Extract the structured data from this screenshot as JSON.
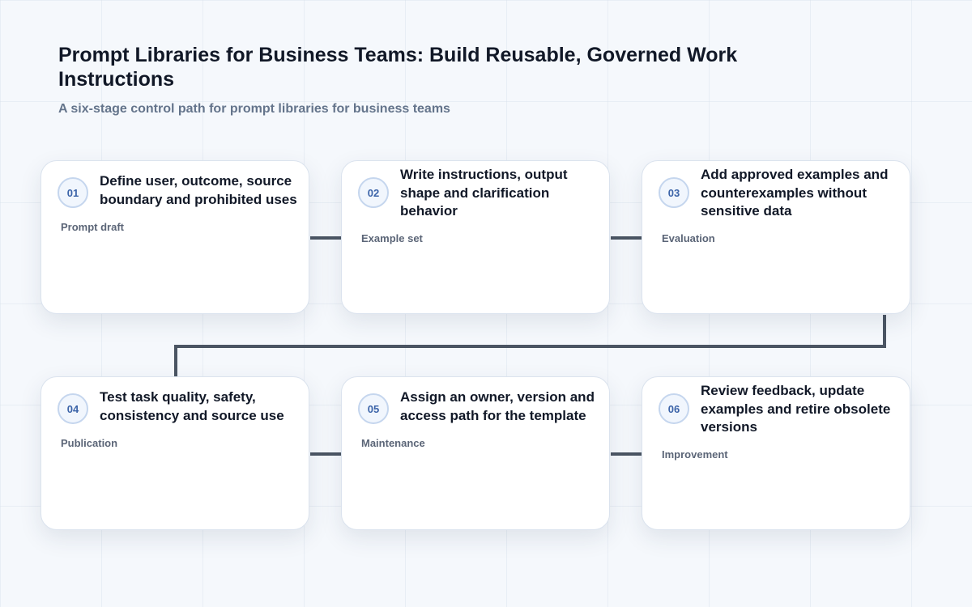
{
  "header": {
    "title": "Prompt Libraries for Business Teams: Build Reusable, Governed Work Instructions",
    "subtitle": "A six-stage control path for prompt libraries for business teams"
  },
  "stages": [
    {
      "num": "01",
      "title": "Define user, outcome, source boundary and prohibited uses",
      "label": "Prompt draft"
    },
    {
      "num": "02",
      "title": "Write instructions, output shape and clarification behavior",
      "label": "Example set"
    },
    {
      "num": "03",
      "title": "Add approved examples and counterexamples without sensitive data",
      "label": "Evaluation"
    },
    {
      "num": "04",
      "title": "Test task quality, safety, consistency and source use",
      "label": "Publication"
    },
    {
      "num": "05",
      "title": "Assign an owner, version and access path for the template",
      "label": "Maintenance"
    },
    {
      "num": "06",
      "title": "Review feedback, update examples and retire obsolete versions",
      "label": "Improvement"
    }
  ],
  "colors": {
    "connector": "#4b5563",
    "badge_text": "#3b63a8",
    "card_bg": "#ffffff",
    "page_bg": "#f5f8fc"
  }
}
